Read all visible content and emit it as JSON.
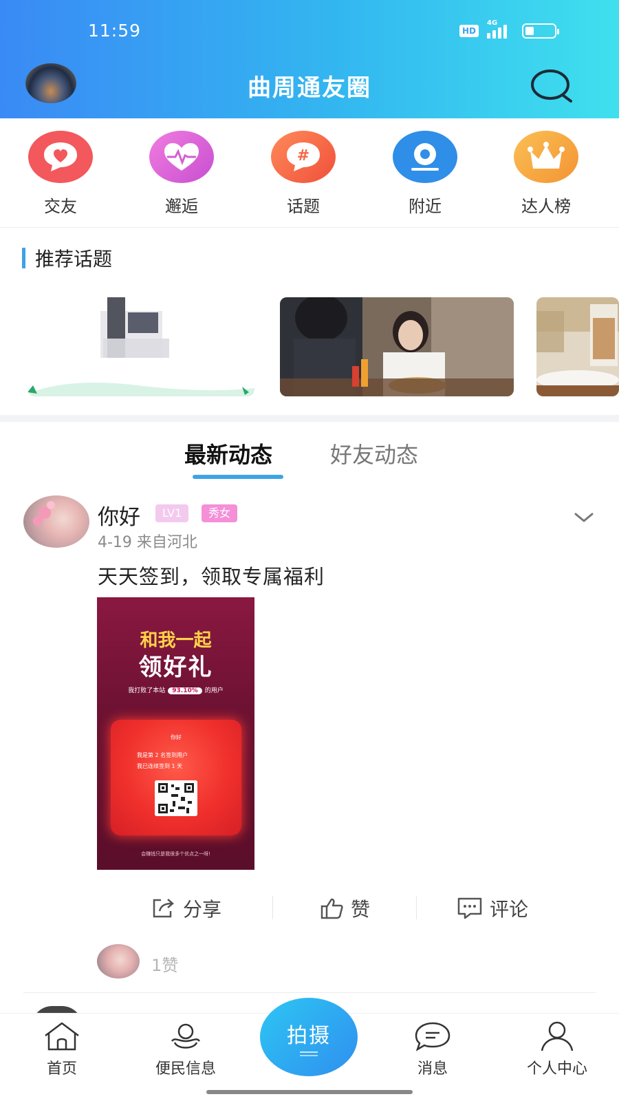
{
  "status_bar": {
    "time": "11:59",
    "hd": "HD",
    "network": "4G"
  },
  "header": {
    "title": "曲周通友圈",
    "search_icon": "search-icon",
    "avatar": "user-avatar"
  },
  "categories": [
    {
      "label": "交友",
      "icon": "heart-chat-icon",
      "color": "#f2585c"
    },
    {
      "label": "邂逅",
      "icon": "heart-pulse-icon",
      "color": "#e26ad4"
    },
    {
      "label": "话题",
      "icon": "hashtag-icon",
      "color": "#f56a48"
    },
    {
      "label": "附近",
      "icon": "location-pin-icon",
      "color": "#2f8ee8"
    },
    {
      "label": "达人榜",
      "icon": "crown-icon",
      "color": "#f7a23e"
    }
  ],
  "recommended": {
    "title": "推荐话题"
  },
  "tabs": [
    {
      "label": "最新动态",
      "active": true
    },
    {
      "label": "好友动态",
      "active": false
    }
  ],
  "post": {
    "username": "你好",
    "level": "LV1",
    "tag": "秀女",
    "meta": "4-19  来自河北",
    "text": "天天签到，领取专属福利",
    "poster": {
      "headline1": "和我一起",
      "headline2": "领好礼",
      "rank_prefix": "我打败了本站",
      "rank_value": "93.10%",
      "rank_suffix": "的用户",
      "card_name": "你好",
      "card_line1": "我是第 2 名签到用户",
      "card_line2": "我已连续签到  1  天",
      "footer": "会赚钱只是我很多个优点之一呀!"
    },
    "actions": {
      "share": "分享",
      "like": "赞",
      "comment": "评论"
    },
    "like_count": "1赞"
  },
  "bottom_nav": {
    "home": "首页",
    "info": "便民信息",
    "shoot": "拍摄",
    "messages": "消息",
    "profile": "个人中心"
  },
  "colors": {
    "accent": "#3ea3e6",
    "header_gradient_start": "#3a8af5",
    "header_gradient_end": "#3fe0ee"
  }
}
